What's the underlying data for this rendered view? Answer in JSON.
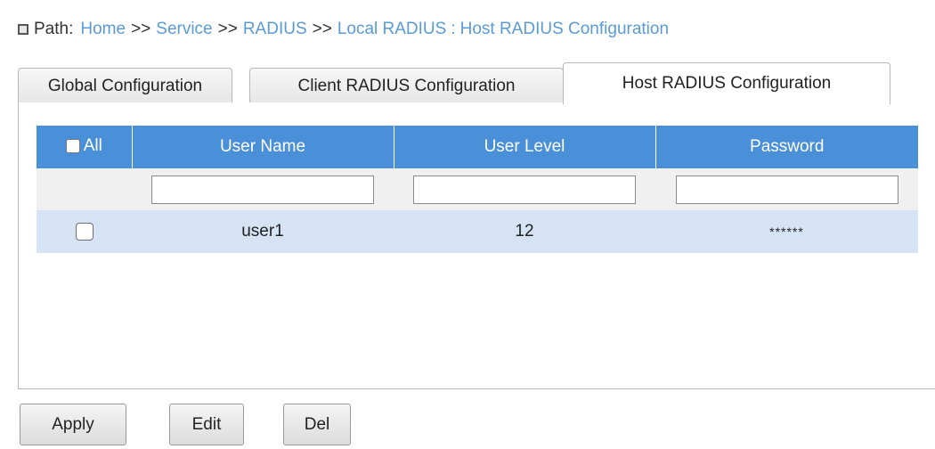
{
  "path": {
    "label": "Path:",
    "crumbs": [
      "Home",
      "Service",
      "RADIUS",
      "Local RADIUS"
    ],
    "separator": ">>",
    "colon": ":",
    "current": "Host RADIUS Configuration"
  },
  "tabs": [
    {
      "label": "Global Configuration",
      "active": false
    },
    {
      "label": "Client RADIUS Configuration",
      "active": false
    },
    {
      "label": "Host RADIUS Configuration",
      "active": true
    }
  ],
  "table": {
    "select_all_label": "All",
    "columns": [
      "User Name",
      "User Level",
      "Password"
    ],
    "filters": {
      "user_name": "",
      "user_level": "",
      "password": ""
    },
    "rows": [
      {
        "checked": false,
        "user_name": "user1",
        "user_level": "12",
        "password": "******"
      }
    ]
  },
  "buttons": {
    "apply": "Apply",
    "edit": "Edit",
    "del": "Del"
  },
  "colors": {
    "header": "#4a90d9",
    "row": "#d5e3f5",
    "filter_row": "#f0f0f0",
    "path_link": "#5a9bd5"
  }
}
